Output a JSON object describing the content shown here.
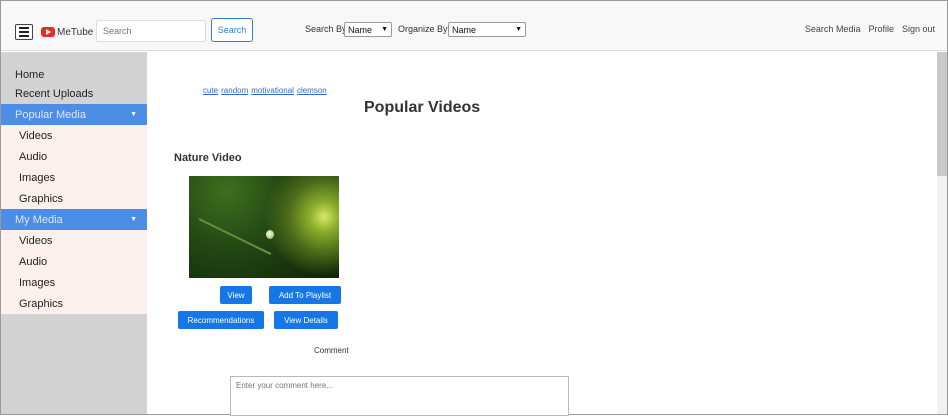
{
  "header": {
    "app_name": "MeTube",
    "search_placeholder": "Search",
    "search_button": "Search",
    "search_by_label": "Search By:",
    "search_by_value": "Name",
    "organize_by_label": "Organize By:",
    "organize_by_value": "Name",
    "nav_links": [
      "Search Media",
      "Profile",
      "Sign out"
    ]
  },
  "sidebar": {
    "home": "Home",
    "recent_uploads": "Recent Uploads",
    "popular_media": {
      "label": "Popular Media",
      "items": [
        "Videos",
        "Audio",
        "Images",
        "Graphics"
      ]
    },
    "my_media": {
      "label": "My Media",
      "items": [
        "Videos",
        "Audio",
        "Images",
        "Graphics"
      ]
    }
  },
  "main": {
    "tags": [
      "cute",
      "random",
      "motivational",
      "clemson"
    ],
    "page_title": "Popular Videos",
    "video_title": "Nature Video",
    "buttons": {
      "view": "View",
      "add_to_playlist": "Add To Playlist",
      "recommendations": "Recommendations",
      "view_details": "View Details"
    },
    "comment_label": "Comment",
    "comment_placeholder": "Enter your comment here..."
  },
  "colors": {
    "accent": "#1476e7",
    "sidebar_header": "#4c8de6",
    "sidebar_bg": "#d3d3d3",
    "sidebar_sub_bg": "#fcf0ec"
  }
}
